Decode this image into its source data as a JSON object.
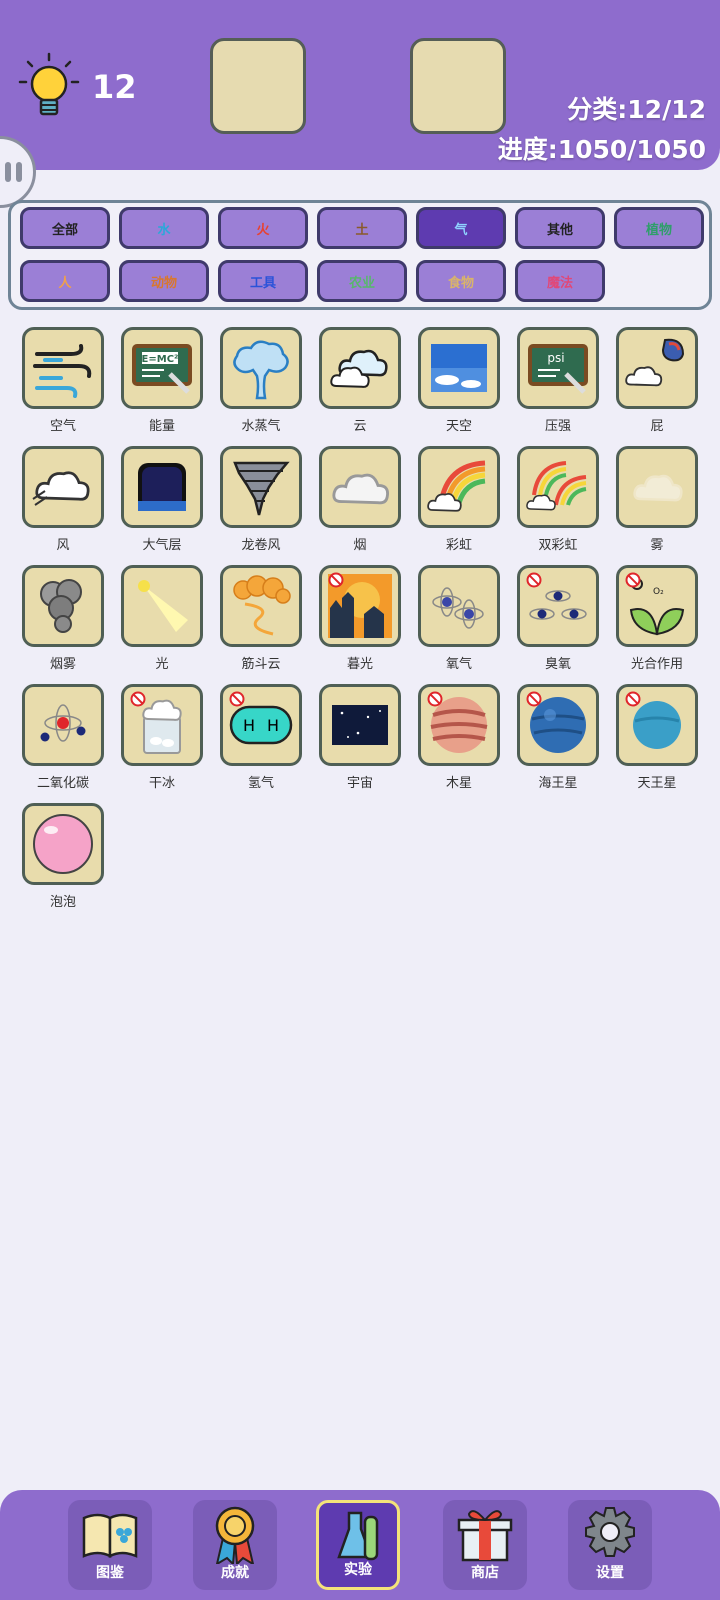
{
  "header": {
    "hint_count": "12",
    "category_stat": "分类:12/12",
    "progress_stat": "进度:1050/1050"
  },
  "filters": [
    {
      "label": "全部",
      "color": "#222222",
      "active": false
    },
    {
      "label": "水",
      "color": "#2aa8d8",
      "active": false
    },
    {
      "label": "火",
      "color": "#e8412f",
      "active": false
    },
    {
      "label": "土",
      "color": "#8a5a2b",
      "active": false
    },
    {
      "label": "气",
      "color": "#8fd3ff",
      "active": true
    },
    {
      "label": "其他",
      "color": "#222222",
      "active": false
    },
    {
      "label": "植物",
      "color": "#2f9e6a",
      "active": false
    },
    {
      "label": "人",
      "color": "#f1a04a",
      "active": false
    },
    {
      "label": "动物",
      "color": "#d9772e",
      "active": false
    },
    {
      "label": "工具",
      "color": "#2a52d9",
      "active": false
    },
    {
      "label": "农业",
      "color": "#57b86a",
      "active": false
    },
    {
      "label": "食物",
      "color": "#d9b46a",
      "active": false
    },
    {
      "label": "魔法",
      "color": "#e04878",
      "active": false
    }
  ],
  "elements": [
    {
      "label": "空气",
      "icon": "wind-icon",
      "blocked": false
    },
    {
      "label": "能量",
      "icon": "chalkboard-emc2-icon",
      "blocked": false
    },
    {
      "label": "水蒸气",
      "icon": "steam-cloud-icon",
      "blocked": false
    },
    {
      "label": "云",
      "icon": "clouds-icon",
      "blocked": false
    },
    {
      "label": "天空",
      "icon": "sky-icon",
      "blocked": false
    },
    {
      "label": "压强",
      "icon": "chalkboard-psi-icon",
      "blocked": false
    },
    {
      "label": "屁",
      "icon": "fart-icon",
      "blocked": false
    },
    {
      "label": "风",
      "icon": "gust-icon",
      "blocked": false
    },
    {
      "label": "大气层",
      "icon": "atmosphere-icon",
      "blocked": false
    },
    {
      "label": "龙卷风",
      "icon": "tornado-icon",
      "blocked": false
    },
    {
      "label": "烟",
      "icon": "smoke-icon",
      "blocked": false
    },
    {
      "label": "彩虹",
      "icon": "rainbow-icon",
      "blocked": false
    },
    {
      "label": "双彩虹",
      "icon": "double-rainbow-icon",
      "blocked": false
    },
    {
      "label": "雾",
      "icon": "fog-icon",
      "blocked": false
    },
    {
      "label": "烟雾",
      "icon": "smog-icon",
      "blocked": false
    },
    {
      "label": "光",
      "icon": "light-beam-icon",
      "blocked": false
    },
    {
      "label": "筋斗云",
      "icon": "magic-cloud-icon",
      "blocked": false
    },
    {
      "label": "暮光",
      "icon": "twilight-icon",
      "blocked": true
    },
    {
      "label": "氧气",
      "icon": "oxygen-icon",
      "blocked": false
    },
    {
      "label": "臭氧",
      "icon": "ozone-icon",
      "blocked": true
    },
    {
      "label": "光合作用",
      "icon": "photosynthesis-icon",
      "blocked": true
    },
    {
      "label": "二氧化碳",
      "icon": "co2-icon",
      "blocked": false
    },
    {
      "label": "干冰",
      "icon": "dry-ice-icon",
      "blocked": true
    },
    {
      "label": "氢气",
      "icon": "hydrogen-icon",
      "blocked": true
    },
    {
      "label": "宇宙",
      "icon": "space-icon",
      "blocked": false
    },
    {
      "label": "木星",
      "icon": "jupiter-icon",
      "blocked": true
    },
    {
      "label": "海王星",
      "icon": "neptune-icon",
      "blocked": true
    },
    {
      "label": "天王星",
      "icon": "uranus-icon",
      "blocked": true
    },
    {
      "label": "泡泡",
      "icon": "bubble-icon",
      "blocked": false
    }
  ],
  "nav": [
    {
      "label": "图鉴",
      "icon": "book-icon",
      "active": false
    },
    {
      "label": "成就",
      "icon": "medal-icon",
      "active": false
    },
    {
      "label": "实验",
      "icon": "flask-icon",
      "active": true
    },
    {
      "label": "商店",
      "icon": "gift-icon",
      "active": false
    },
    {
      "label": "设置",
      "icon": "gear-icon",
      "active": false
    }
  ]
}
